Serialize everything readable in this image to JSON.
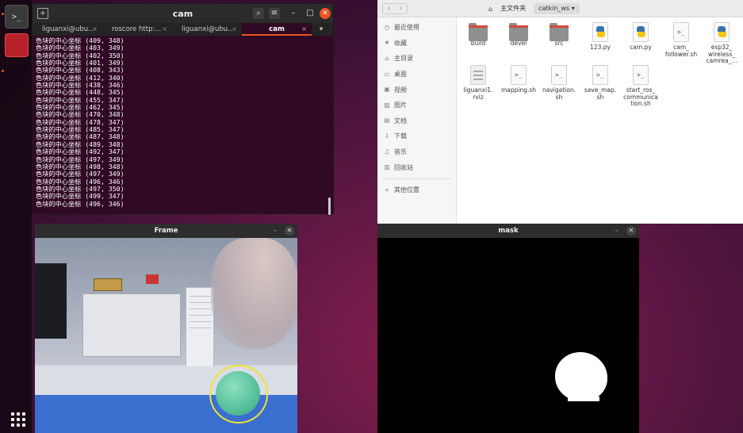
{
  "terminal": {
    "title": "cam",
    "tabs": [
      {
        "label": "liguanxi@ubu..."
      },
      {
        "label": "roscore http:..."
      },
      {
        "label": "liguanxi@ubu..."
      },
      {
        "label": "cam"
      }
    ],
    "lines": [
      "色块的中心坐标 (409, 348)",
      "色块的中心坐标 (403, 349)",
      "色块的中心坐标 (402, 350)",
      "色块的中心坐标 (401, 349)",
      "色块的中心坐标 (408, 343)",
      "色块的中心坐标 (412, 340)",
      "色块的中心坐标 (438, 346)",
      "色块的中心坐标 (448, 345)",
      "色块的中心坐标 (455, 347)",
      "色块的中心坐标 (462, 345)",
      "色块的中心坐标 (470, 348)",
      "色块的中心坐标 (478, 347)",
      "色块的中心坐标 (485, 347)",
      "色块的中心坐标 (487, 348)",
      "色块的中心坐标 (489, 348)",
      "色块的中心坐标 (492, 347)",
      "色块的中心坐标 (497, 349)",
      "色块的中心坐标 (498, 348)",
      "色块的中心坐标 (497, 349)",
      "色块的中心坐标 (496, 346)",
      "色块的中心坐标 (497, 350)",
      "色块的中心坐标 (499, 347)",
      "色块的中心坐标 (496, 346)"
    ]
  },
  "file_manager": {
    "breadcrumb": {
      "home": "主文件夹",
      "current": "catkin_ws"
    },
    "sidebar": [
      {
        "label": "最近使用",
        "icon": "clock-icon"
      },
      {
        "label": "收藏",
        "icon": "star-icon"
      },
      {
        "label": "主目录",
        "icon": "home-icon"
      },
      {
        "label": "桌面",
        "icon": "desktop-icon"
      },
      {
        "label": "视频",
        "icon": "video-icon"
      },
      {
        "label": "图片",
        "icon": "image-icon"
      },
      {
        "label": "文档",
        "icon": "document-icon"
      },
      {
        "label": "下载",
        "icon": "download-icon"
      },
      {
        "label": "音乐",
        "icon": "music-icon"
      },
      {
        "label": "回收站",
        "icon": "trash-icon"
      },
      {
        "label": "其他位置",
        "icon": "plus-icon"
      }
    ],
    "files": [
      {
        "name": "build",
        "kind": "folder"
      },
      {
        "name": "devel",
        "kind": "folder"
      },
      {
        "name": "src",
        "kind": "folder"
      },
      {
        "name": "123.py",
        "kind": "python"
      },
      {
        "name": "cam.py",
        "kind": "python"
      },
      {
        "name": "cam_\nfollower.sh",
        "kind": "script"
      },
      {
        "name": "esp32_\nwireless_\ncamrea_...",
        "kind": "python"
      },
      {
        "name": "liguanxi1.\nrviz",
        "kind": "rviz"
      },
      {
        "name": "mapping.sh",
        "kind": "script"
      },
      {
        "name": "navigation.\nsh",
        "kind": "script"
      },
      {
        "name": "save_map.\nsh",
        "kind": "script"
      },
      {
        "name": "start_ros_\ncommunica\ntion.sh",
        "kind": "script"
      }
    ]
  },
  "frame_window": {
    "title": "Frame"
  },
  "mask_window": {
    "title": "mask"
  },
  "colors": {
    "accent": "#e95420",
    "terminal_bg": "#300a24",
    "detect_circle": "#f1e431",
    "ball": "#55c09a"
  }
}
